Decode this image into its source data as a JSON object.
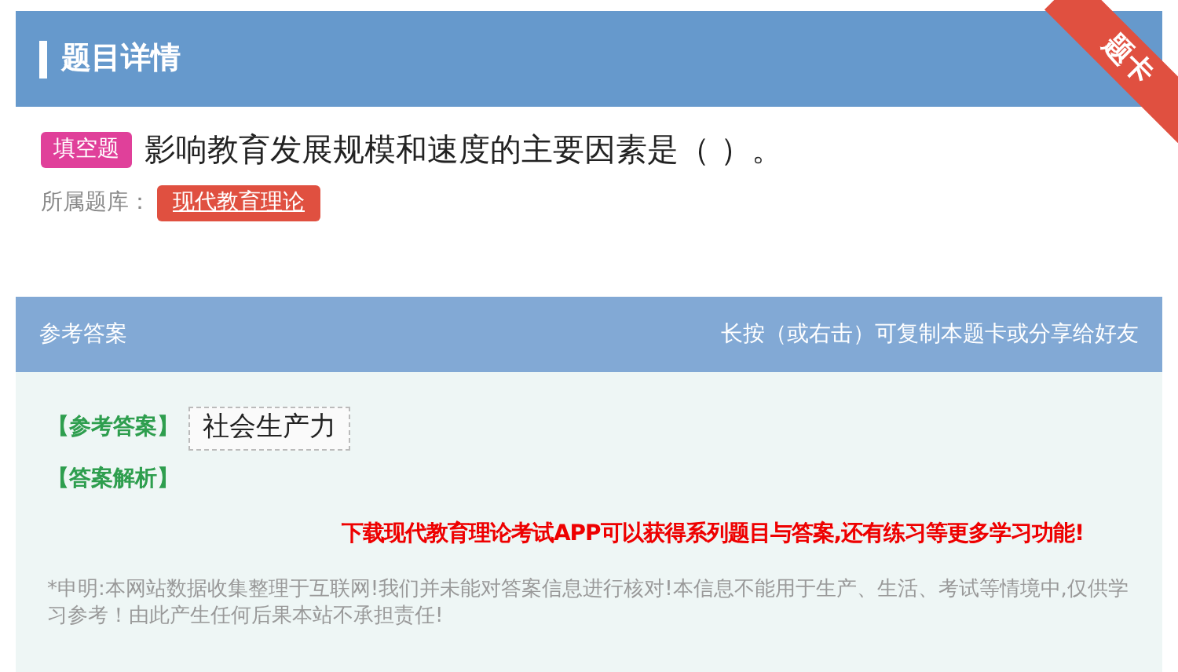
{
  "header": {
    "title": "题目详情",
    "ribbon": "题卡"
  },
  "question": {
    "type_tag": "填空题",
    "text": "影响教育发展规模和速度的主要因素是（ ）。"
  },
  "library": {
    "label": "所属题库：",
    "tag": "现代教育理论"
  },
  "answer_bar": {
    "title": "参考答案",
    "hint": "长按（或右击）可复制本题卡或分享给好友"
  },
  "answer": {
    "label": "【参考答案】",
    "value": "社会生产力"
  },
  "analysis": {
    "label": "【答案解析】"
  },
  "promo": "下载现代教育理论考试APP可以获得系列题目与答案,还有练习等更多学习功能!",
  "disclaimer": "*申明:本网站数据收集整理于互联网!我们并未能对答案信息进行核对!本信息不能用于生产、生活、考试等情境中,仅供学习参考！由此产生任何后果本站不承担责任!"
}
